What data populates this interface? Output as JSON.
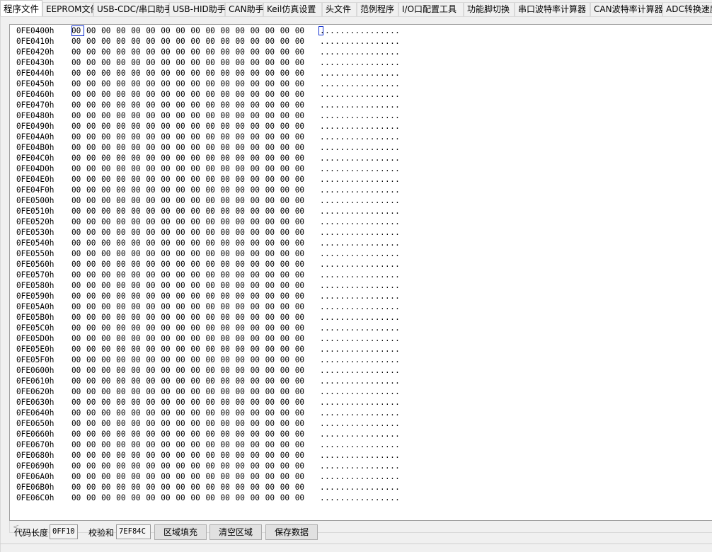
{
  "tabs": [
    {
      "label": "程序文件",
      "active": true
    },
    {
      "label": "EEPROM文件"
    },
    {
      "label": "USB-CDC/串口助手"
    },
    {
      "label": "USB-HID助手"
    },
    {
      "label": "CAN助手"
    },
    {
      "label": "Keil仿真设置"
    },
    {
      "label": "头文件"
    },
    {
      "label": "范例程序"
    },
    {
      "label": "I/O口配置工具"
    },
    {
      "label": "功能脚切换"
    },
    {
      "label": "串口波特率计算器"
    },
    {
      "label": "CAN波特率计算器"
    },
    {
      "label": "ADC转换速度"
    }
  ],
  "hex": {
    "addresses": [
      "0FE0400h",
      "0FE0410h",
      "0FE0420h",
      "0FE0430h",
      "0FE0440h",
      "0FE0450h",
      "0FE0460h",
      "0FE0470h",
      "0FE0480h",
      "0FE0490h",
      "0FE04A0h",
      "0FE04B0h",
      "0FE04C0h",
      "0FE04D0h",
      "0FE04E0h",
      "0FE04F0h",
      "0FE0500h",
      "0FE0510h",
      "0FE0520h",
      "0FE0530h",
      "0FE0540h",
      "0FE0550h",
      "0FE0560h",
      "0FE0570h",
      "0FE0580h",
      "0FE0590h",
      "0FE05A0h",
      "0FE05B0h",
      "0FE05C0h",
      "0FE05D0h",
      "0FE05E0h",
      "0FE05F0h",
      "0FE0600h",
      "0FE0610h",
      "0FE0620h",
      "0FE0630h",
      "0FE0640h",
      "0FE0650h",
      "0FE0660h",
      "0FE0670h",
      "0FE0680h",
      "0FE0690h",
      "0FE06A0h",
      "0FE06B0h",
      "0FE06C0h"
    ],
    "byte_value": "00",
    "bytes_per_row": 16,
    "ascii_text": "................",
    "selected_row": 0,
    "selected_byte": 0
  },
  "scroll": {
    "left_arrow": "<"
  },
  "bottom": {
    "code_length_label": "代码长度",
    "code_length_value": "0FF10",
    "checksum_label": "校验和",
    "checksum_value": "7EF84C",
    "fill_button": "区域填充",
    "clear_button": "清空区域",
    "save_button": "保存数据"
  },
  "colors": {
    "selection": "#1030d0",
    "panel_bg": "#f0f0f0",
    "hex_bg": "#ffffff"
  }
}
